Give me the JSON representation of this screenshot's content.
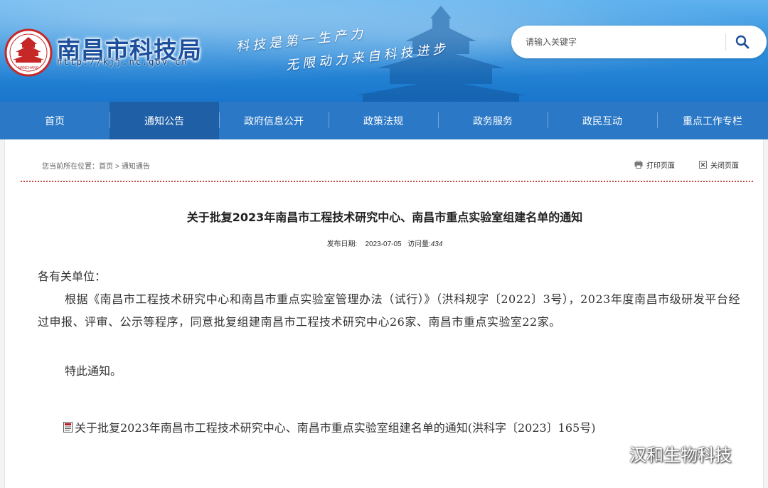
{
  "header": {
    "site_name": "南昌市科技局",
    "site_url": "http://kjj.nc.gov.cn",
    "slogan_line1": "科技是第一生产力",
    "slogan_line2": "无限动力来自科技进步",
    "logo_text": "NANCHANG",
    "search": {
      "placeholder": "请输入关键字"
    }
  },
  "nav": {
    "items": [
      {
        "label": "首页"
      },
      {
        "label": "通知公告"
      },
      {
        "label": "政府信息公开"
      },
      {
        "label": "政策法规"
      },
      {
        "label": "政务服务"
      },
      {
        "label": "政民互动"
      },
      {
        "label": "重点工作专栏"
      }
    ],
    "active_index": 1
  },
  "breadcrumb": {
    "prefix": "您当前所在位置：",
    "items": [
      "首页",
      "通知通告"
    ],
    "separator": ">"
  },
  "tools": {
    "print": "打印页面",
    "close": "关闭页面"
  },
  "article": {
    "title": "关于批复2023年南昌市工程技术研究中心、南昌市重点实验室组建名单的通知",
    "date_label": "发布日期:",
    "date": "2023-07-05",
    "views_label": "访问量:",
    "views": "434",
    "salutation": "各有关单位：",
    "paragraph": "根据《南昌市工程技术研究中心和南昌市重点实验室管理办法（试行）》（洪科规字〔2022〕3号），2023年度南昌市级研发平台经过申报、评审、公示等程序，同意批复组建南昌市工程技术研究中心26家、南昌市重点实验室22家。",
    "closing": "特此通知。",
    "attachment": "关于批复2023年南昌市工程技术研究中心、南昌市重点实验室组建名单的通知(洪科字〔2023〕165号)"
  },
  "watermark": {
    "text": "汉和生物科技"
  },
  "colors": {
    "nav_bg": "#2b78c6",
    "nav_active": "#1e5fa6",
    "dotted_rule": "#c24a4a",
    "site_name": "#1c4f9c"
  }
}
